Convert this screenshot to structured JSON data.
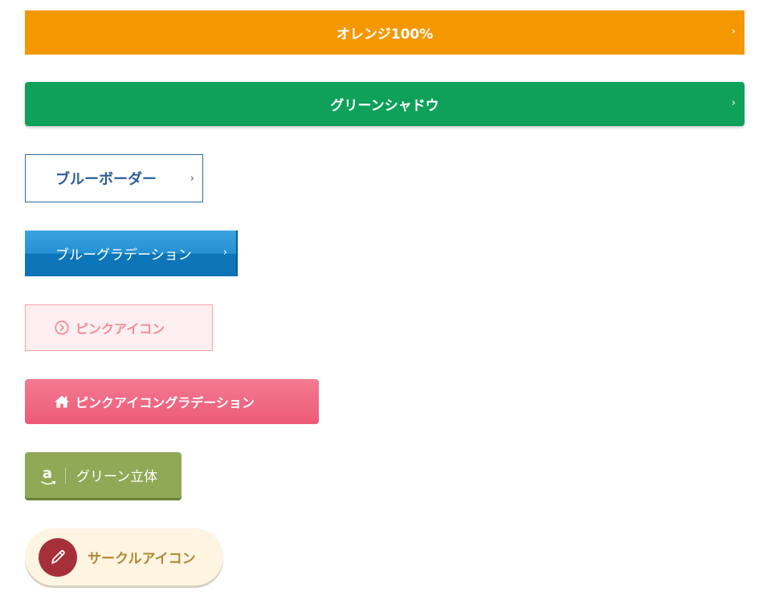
{
  "buttons": {
    "orange": {
      "label": "オレンジ100%",
      "chevron": "›",
      "color": "#f39800"
    },
    "green_shadow": {
      "label": "グリーンシャドウ",
      "chevron": "›",
      "color": "#0fa05a"
    },
    "blue_border": {
      "label": "ブルーボーダー",
      "chevron": "›",
      "color": "#2c6ba6"
    },
    "blue_gradient": {
      "label": "ブルーグラデーション",
      "chevron": "›",
      "color": "#1a84c9"
    },
    "pink_icon": {
      "label": "ピンクアイコン",
      "icon": "circle-chevron-right-icon",
      "color": "#ee8d99"
    },
    "pink_icon_gradient": {
      "label": "ピンクアイコングラデーション",
      "icon": "home-icon",
      "color": "#ec5a77"
    },
    "green_3d": {
      "label": "グリーン立体",
      "icon": "amazon-icon",
      "icon_glyph": "a",
      "color": "#8fa956"
    },
    "circle_icon": {
      "label": "サークルアイコン",
      "icon": "pencil-icon",
      "color": "#a5303a"
    }
  }
}
